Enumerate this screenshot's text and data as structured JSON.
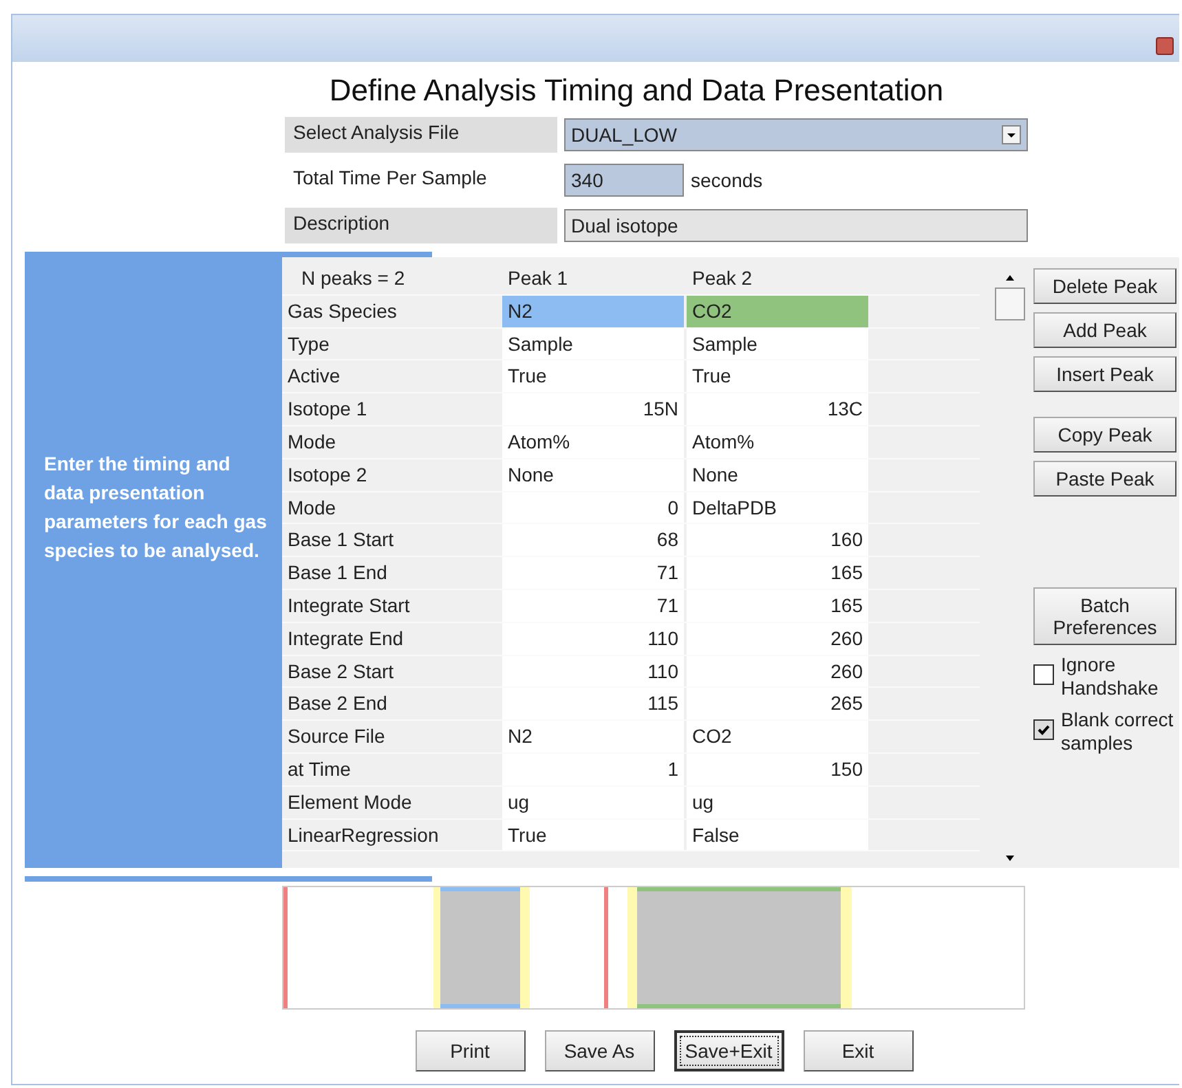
{
  "window": {
    "title": "Define Analysis Timing and Data Presentation"
  },
  "form": [
    {
      "label": "Select Analysis  File",
      "kind": "dropdown",
      "value": "DUAL_LOW"
    },
    {
      "label": "Total Time Per Sample",
      "kind": "number",
      "value": "340",
      "unit": "seconds"
    },
    {
      "label": "Description",
      "kind": "text",
      "value": "Dual isotope"
    }
  ],
  "hint": "Enter the timing and data presentation parameters for each gas species to be analysed.",
  "table": {
    "header": "N peaks = 2",
    "columns": [
      "Peak 1",
      "Peak 2"
    ],
    "rows": [
      {
        "label": "Gas Species",
        "cells": [
          {
            "text": "N2",
            "kind": "species",
            "color": "#8cbcf2"
          },
          {
            "text": "CO2",
            "kind": "species",
            "color": "#90c47e"
          }
        ]
      },
      {
        "label": "Type",
        "cells": [
          {
            "text": "Sample",
            "kind": "text"
          },
          {
            "text": "Sample",
            "kind": "text"
          }
        ]
      },
      {
        "label": "Active",
        "cells": [
          {
            "text": "True",
            "kind": "text"
          },
          {
            "text": "True",
            "kind": "text"
          }
        ]
      },
      {
        "label": "Isotope 1",
        "cells": [
          {
            "text": "15N",
            "kind": "number"
          },
          {
            "text": "13C",
            "kind": "number"
          }
        ]
      },
      {
        "label": "Mode",
        "cells": [
          {
            "text": "Atom%",
            "kind": "text"
          },
          {
            "text": "Atom%",
            "kind": "text"
          }
        ]
      },
      {
        "label": "Isotope 2",
        "cells": [
          {
            "text": "None",
            "kind": "text"
          },
          {
            "text": "None",
            "kind": "text"
          }
        ]
      },
      {
        "label": "Mode",
        "cells": [
          {
            "text": "0",
            "kind": "number"
          },
          {
            "text": "DeltaPDB",
            "kind": "text"
          }
        ]
      },
      {
        "label": "Base 1 Start",
        "cells": [
          {
            "text": "68",
            "kind": "number"
          },
          {
            "text": "160",
            "kind": "number"
          }
        ]
      },
      {
        "label": "Base 1 End",
        "cells": [
          {
            "text": "71",
            "kind": "number"
          },
          {
            "text": "165",
            "kind": "number"
          }
        ]
      },
      {
        "label": "Integrate Start",
        "cells": [
          {
            "text": "71",
            "kind": "number"
          },
          {
            "text": "165",
            "kind": "number"
          }
        ]
      },
      {
        "label": "Integrate End",
        "cells": [
          {
            "text": "110",
            "kind": "number"
          },
          {
            "text": "260",
            "kind": "number"
          }
        ]
      },
      {
        "label": "Base 2 Start",
        "cells": [
          {
            "text": "110",
            "kind": "number"
          },
          {
            "text": "260",
            "kind": "number"
          }
        ]
      },
      {
        "label": "Base 2 End",
        "cells": [
          {
            "text": "115",
            "kind": "number"
          },
          {
            "text": "265",
            "kind": "number"
          }
        ]
      },
      {
        "label": "Source File",
        "cells": [
          {
            "text": "N2",
            "kind": "text"
          },
          {
            "text": "CO2",
            "kind": "text"
          }
        ]
      },
      {
        "label": "at Time",
        "cells": [
          {
            "text": "1",
            "kind": "number"
          },
          {
            "text": "150",
            "kind": "number"
          }
        ]
      },
      {
        "label": "Element Mode",
        "cells": [
          {
            "text": "ug",
            "kind": "text"
          },
          {
            "text": "ug",
            "kind": "text"
          }
        ]
      },
      {
        "label": "LinearRegression",
        "cells": [
          {
            "text": "True",
            "kind": "text"
          },
          {
            "text": "False",
            "kind": "text"
          }
        ]
      }
    ]
  },
  "side_buttons": [
    "Delete Peak",
    "Add Peak",
    "Insert Peak",
    "Copy Peak",
    "Paste Peak",
    "Batch Preferences"
  ],
  "options": [
    {
      "label": "Ignore Handshake",
      "checked": false
    },
    {
      "label": "Blank correct samples",
      "checked": true
    }
  ],
  "buttons": [
    {
      "label": "Print",
      "default": false
    },
    {
      "label": "Save As",
      "default": false
    },
    {
      "label": "Save+Exit",
      "default": true
    },
    {
      "label": "Exit",
      "default": false
    }
  ]
}
